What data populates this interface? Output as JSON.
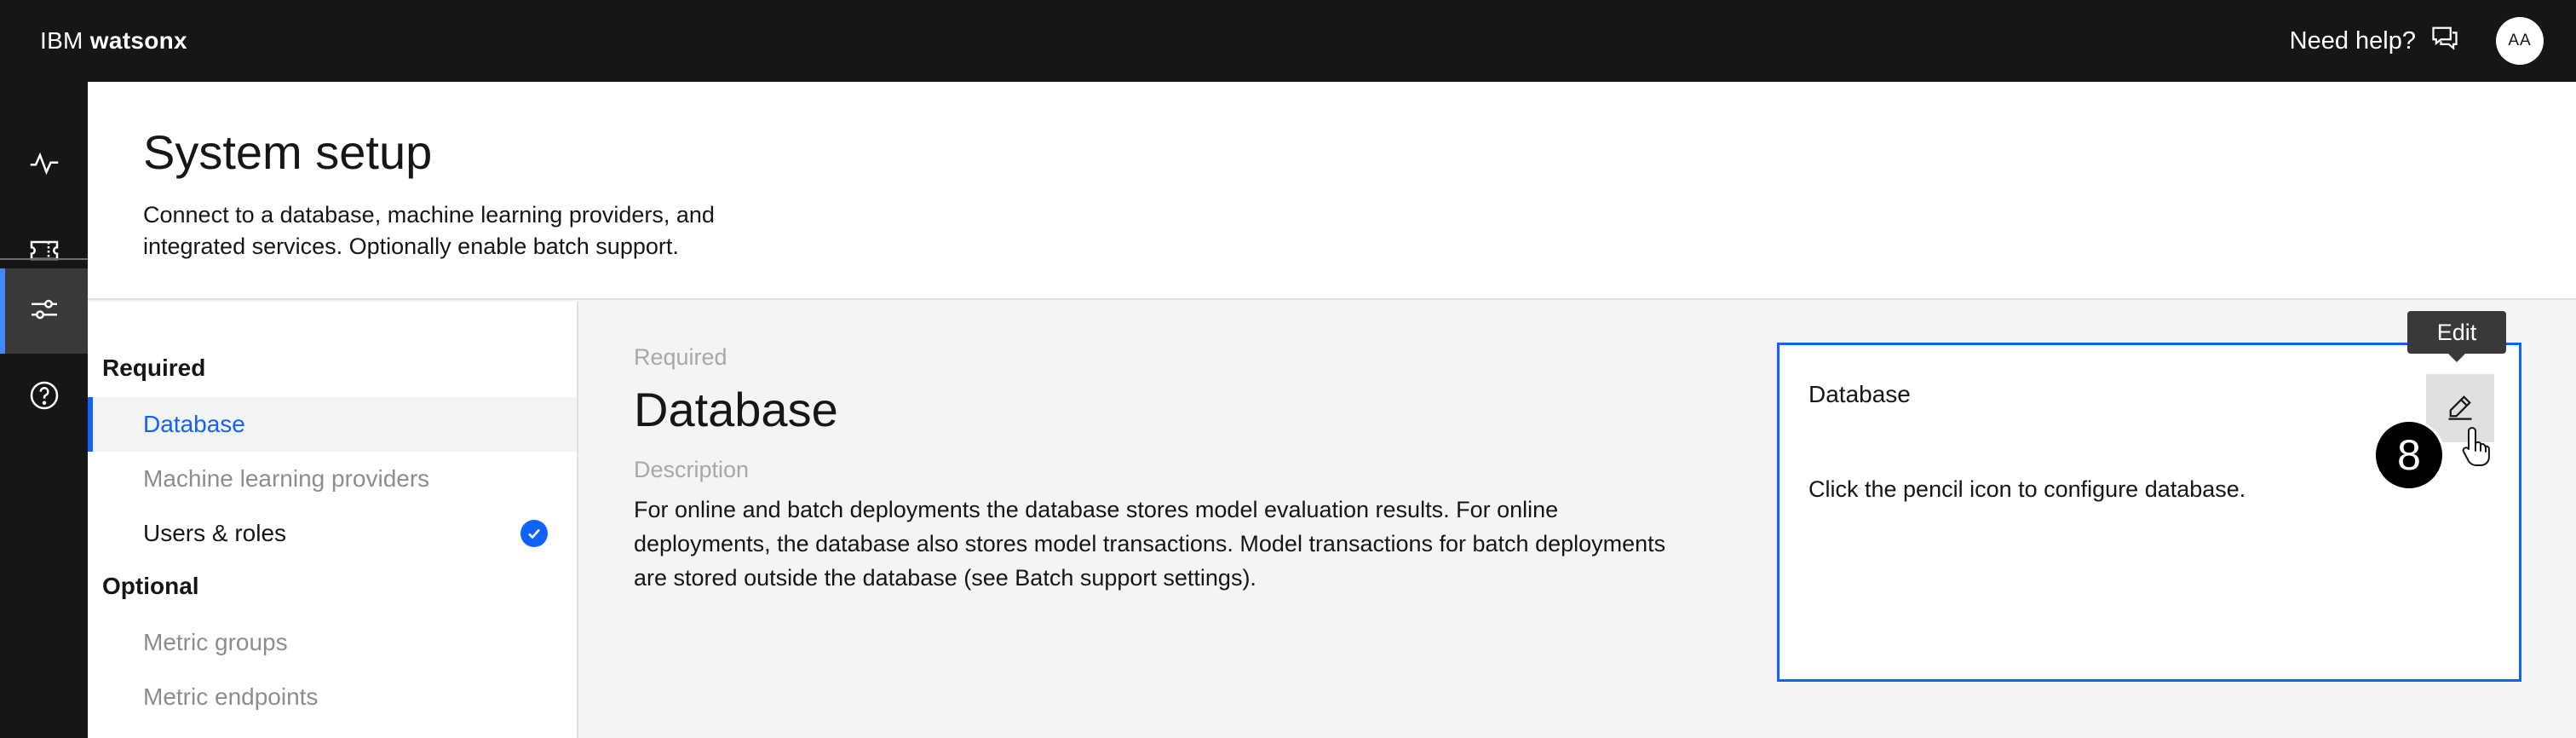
{
  "app": {
    "brand_prefix": "IBM",
    "brand_name": "watsonx"
  },
  "topbar": {
    "help_label": "Need help?",
    "avatar_initials": "AA"
  },
  "sidenav": {
    "items": [
      {
        "icon": "activity-icon"
      },
      {
        "icon": "ticket-icon"
      },
      {
        "icon": "settings-adjust-icon",
        "active": true
      },
      {
        "icon": "help-icon"
      }
    ]
  },
  "header": {
    "title": "System setup",
    "description": "Connect to a database, machine learning providers, and integrated services. Optionally enable batch support."
  },
  "setup_nav": {
    "required_heading": "Required",
    "required_items": [
      {
        "label": "Database",
        "state": "selected"
      },
      {
        "label": "Machine learning providers",
        "state": "pending"
      },
      {
        "label": "Users & roles",
        "state": "complete"
      }
    ],
    "optional_heading": "Optional",
    "optional_items": [
      {
        "label": "Metric groups"
      },
      {
        "label": "Metric endpoints"
      }
    ]
  },
  "detail": {
    "eyebrow": "Required",
    "title": "Database",
    "description_label": "Description",
    "description": "For online and batch deployments the database stores model evaluation results. For online deployments, the database also stores model transactions. Model transactions for batch deployments are stored outside the database (see Batch support settings)."
  },
  "card": {
    "title": "Database",
    "message": "Click the pencil icon to configure database.",
    "edit_tooltip": "Edit"
  },
  "annotation": {
    "step_number": "8"
  },
  "colors": {
    "accent": "#0f62fe",
    "topbar": "#161616",
    "selected_indicator": "#4589ff"
  }
}
